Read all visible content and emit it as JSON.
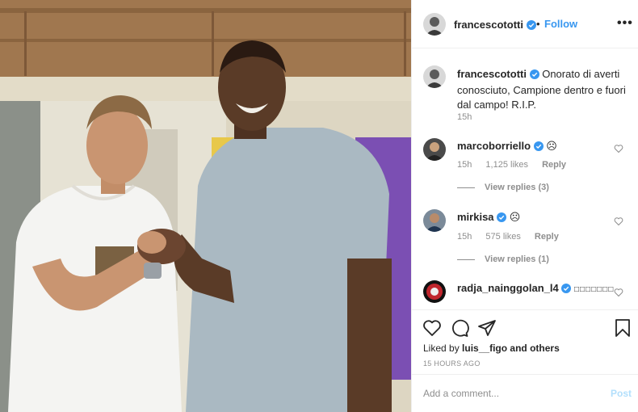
{
  "post": {
    "author": "francescototti",
    "follow_label": "Follow",
    "header_separator": "•",
    "more_label": "•••",
    "caption": "Onorato di averti conosciuto, Campione dentro e fuori dal campo! R.I.P.",
    "caption_time": "15h",
    "photo_icon": "photo",
    "accent_color": "#3897f0",
    "verified_icon": "verified-badge-icon"
  },
  "comments": [
    {
      "user": "marcoborriello",
      "text": "☹",
      "time": "15h",
      "likes": "1,125 likes",
      "reply": "Reply",
      "view_replies": "View replies (3)"
    },
    {
      "user": "mirkisa",
      "text": "☹",
      "time": "15h",
      "likes": "575 likes",
      "reply": "Reply",
      "view_replies": "View replies (1)"
    },
    {
      "user": "radja_nainggolan_l4",
      "text": "□□□□□□□"
    }
  ],
  "engagement": {
    "liked_prefix": "Liked by",
    "liked_user": "luis__figo",
    "liked_suffix": "and others",
    "time_ago": "15 HOURS AGO"
  },
  "composer": {
    "placeholder": "Add a comment...",
    "post_label": "Post"
  }
}
